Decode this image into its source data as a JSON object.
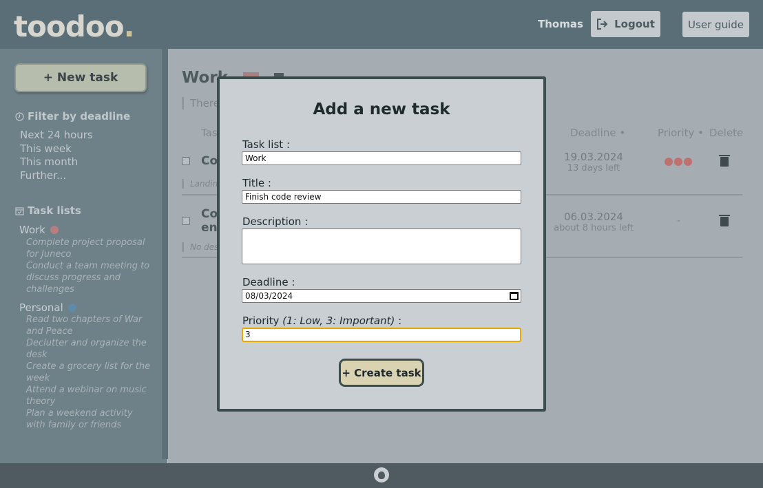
{
  "header": {
    "logo_text": "toodoo",
    "logo_dot": ".",
    "user_name": "Thomas",
    "logout_label": "Logout",
    "user_guide_label": "User guide"
  },
  "sidebar": {
    "new_task_label": "+ New task",
    "filter_heading": "Filter by deadline",
    "filters": [
      "Next 24 hours",
      "This week",
      "This month",
      "Further..."
    ],
    "task_lists_heading": "Task lists",
    "lists": [
      {
        "name": "Work",
        "color": "#b87e7e",
        "tasks": [
          "Complete project proposal for Juneco",
          "Conduct a team meeting to discuss progress and challenges"
        ]
      },
      {
        "name": "Personal",
        "color": "#5f8aa8",
        "tasks": [
          "Read two chapters of War and Peace",
          "Declutter and organize the desk",
          "Create a grocery list for the week",
          "Attend a webinar on music theory",
          "Plan a weekend activity with family or friends"
        ]
      }
    ]
  },
  "main": {
    "title": "Work",
    "description_visible": "There",
    "columns": {
      "task": "Tas",
      "deadline": "Deadline •",
      "priority": "Priority •",
      "delete": "Delete"
    },
    "rows": [
      {
        "title_visible": "Co",
        "subtitle_visible": "Landing",
        "deadline": "19.03.2024",
        "time_left": "13 days left",
        "priority": 3
      },
      {
        "title_visible_1": "Co",
        "title_visible_2": "en",
        "subtitle_visible": "No desc",
        "deadline": "06.03.2024",
        "time_left": "about 8 hours left",
        "priority_text": "-"
      }
    ]
  },
  "modal": {
    "title": "Add a new task",
    "task_list_label": "Task list :",
    "task_list_value": "Work",
    "title_label": "Title :",
    "title_value": "Finish code review",
    "description_label": "Description :",
    "description_value": "",
    "deadline_label": "Deadline :",
    "deadline_value": "08/03/2024",
    "priority_label": "Priority",
    "priority_hint": "(1: Low, 3: Important)",
    "priority_colon": " :",
    "priority_value": "3",
    "create_label": "+ Create task"
  }
}
